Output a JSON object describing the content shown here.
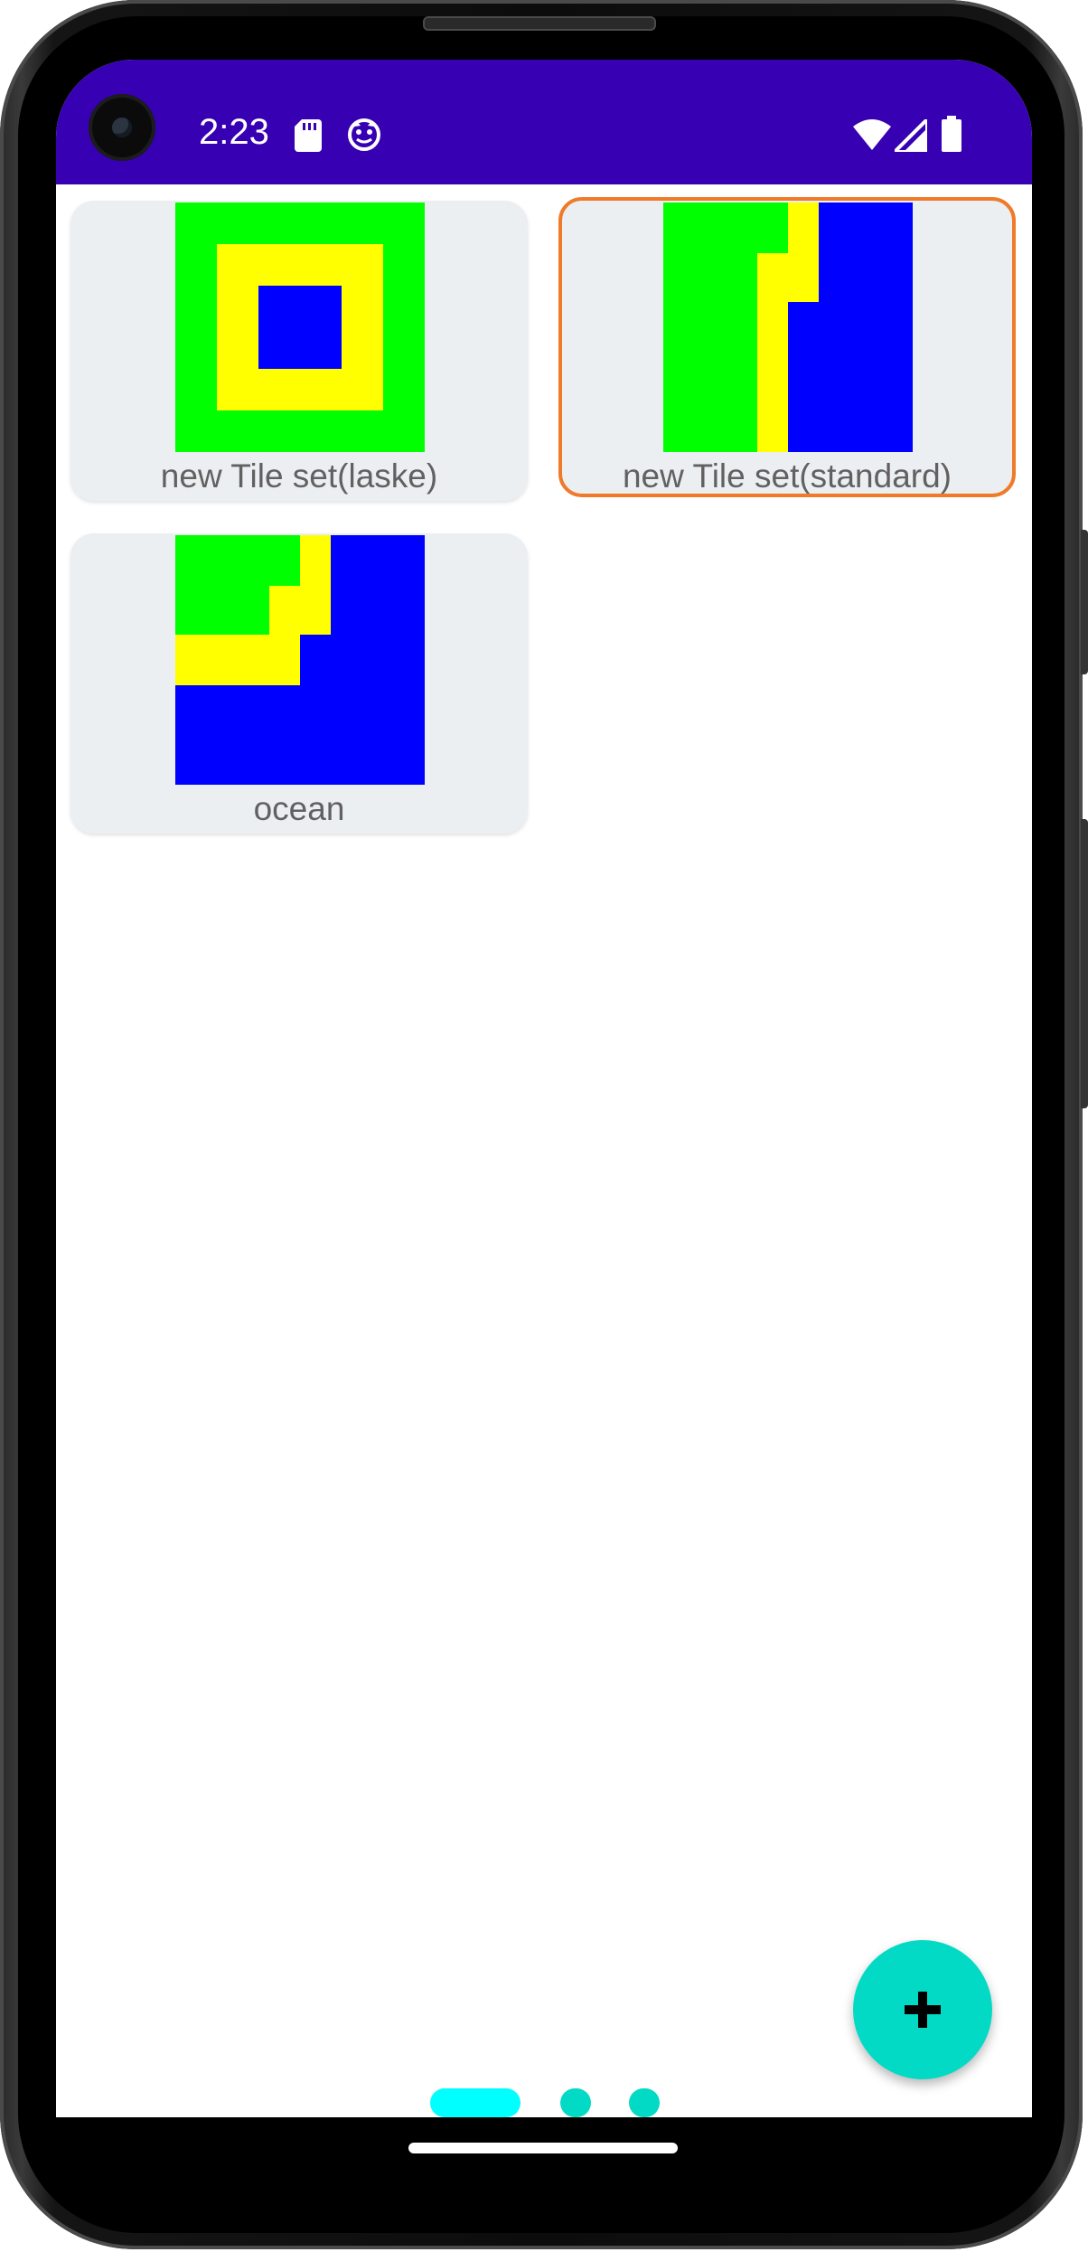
{
  "status_bar": {
    "time": "2:23",
    "background_color": "#3700b3",
    "left_icons": [
      "sd-card-icon",
      "app-notification-icon"
    ],
    "right_icons": [
      "wifi-icon",
      "cell-signal-icon",
      "battery-icon"
    ]
  },
  "tile_sets": [
    {
      "name": "new Tile set(laske)",
      "selected": false,
      "preview": "green border, yellow ring, blue center"
    },
    {
      "name": "new Tile set(standard)",
      "selected": true,
      "preview": "green left, yellow stepped edge, blue right"
    },
    {
      "name": "ocean",
      "selected": false,
      "preview": "green top-left, yellow stepped edge, blue remainder"
    }
  ],
  "fab": {
    "label": "+",
    "background_color": "#03dac5"
  },
  "page_indicator": {
    "pages": 3,
    "current_page": 1,
    "active_color": "#00ffff",
    "inactive_color": "#03dac5"
  },
  "colors": {
    "selection_border": "#ef7a29",
    "card_background": "#eceff1",
    "tile_green": "#00ff00",
    "tile_yellow": "#ffff00",
    "tile_blue": "#0000ff"
  }
}
